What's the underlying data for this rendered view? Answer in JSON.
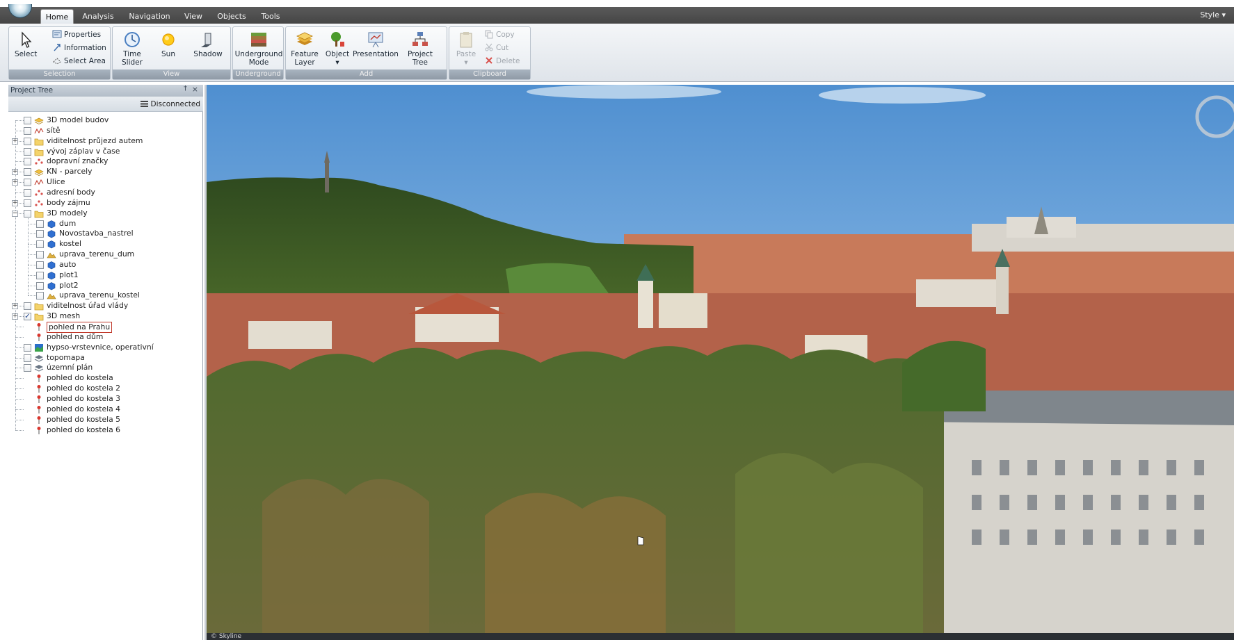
{
  "tabs": [
    "Home",
    "Analysis",
    "Navigation",
    "View",
    "Objects",
    "Tools"
  ],
  "style_menu": "Style",
  "ribbon": {
    "selection": {
      "label": "Selection",
      "select": "Select",
      "properties": "Properties",
      "information": "Information",
      "select_area": "Select Area"
    },
    "view": {
      "label": "View",
      "time_slider_1": "Time",
      "time_slider_2": "Slider",
      "sun": "Sun",
      "shadow": "Shadow"
    },
    "underground": {
      "label": "Underground",
      "mode_1": "Underground",
      "mode_2": "Mode"
    },
    "add": {
      "label": "Add",
      "feature_layer_1": "Feature",
      "feature_layer_2": "Layer",
      "object": "Object",
      "presentation": "Presentation",
      "project_tree_1": "Project",
      "project_tree_2": "Tree"
    },
    "clipboard": {
      "label": "Clipboard",
      "paste": "Paste",
      "copy": "Copy",
      "cut": "Cut",
      "delete": "Delete"
    }
  },
  "panel": {
    "title": "Project Tree",
    "pin": "†",
    "close": "×",
    "connection": "Disconnected"
  },
  "tree": [
    {
      "label": "3D model budov",
      "icon": "layer-icon",
      "expander": "",
      "level": 0,
      "checked": false
    },
    {
      "label": "sítě",
      "icon": "network-icon",
      "expander": "",
      "level": 0,
      "checked": false
    },
    {
      "label": "viditelnost průjezd autem",
      "icon": "folder-icon",
      "expander": "+",
      "level": 0,
      "checked": false
    },
    {
      "label": "vývoj záplav v čase",
      "icon": "folder-icon",
      "expander": "",
      "level": 0,
      "checked": false
    },
    {
      "label": "dopravní značky",
      "icon": "points-icon",
      "expander": "",
      "level": 0,
      "checked": false
    },
    {
      "label": "KN - parcely",
      "icon": "layer-icon",
      "expander": "+",
      "level": 0,
      "checked": false
    },
    {
      "label": "Ulice",
      "icon": "network-icon",
      "expander": "+",
      "level": 0,
      "checked": false
    },
    {
      "label": "adresní body",
      "icon": "points-icon",
      "expander": "",
      "level": 0,
      "checked": false
    },
    {
      "label": "body zájmu",
      "icon": "points-icon",
      "expander": "+",
      "level": 0,
      "checked": false
    },
    {
      "label": "3D modely",
      "icon": "folder-icon",
      "expander": "−",
      "level": 0,
      "checked": false
    },
    {
      "label": "dum",
      "icon": "model-icon",
      "expander": "",
      "level": 1,
      "checked": false
    },
    {
      "label": "Novostavba_nastrel",
      "icon": "model-icon",
      "expander": "",
      "level": 1,
      "checked": false
    },
    {
      "label": "kostel",
      "icon": "model-icon",
      "expander": "",
      "level": 1,
      "checked": false
    },
    {
      "label": "uprava_terenu_dum",
      "icon": "terrain-icon",
      "expander": "",
      "level": 1,
      "checked": false
    },
    {
      "label": "auto",
      "icon": "model-icon",
      "expander": "",
      "level": 1,
      "checked": false
    },
    {
      "label": "plot1",
      "icon": "model-icon",
      "expander": "",
      "level": 1,
      "checked": false
    },
    {
      "label": "plot2",
      "icon": "model-icon",
      "expander": "",
      "level": 1,
      "checked": false
    },
    {
      "label": "uprava_terenu_kostel",
      "icon": "terrain-icon",
      "expander": "",
      "level": 1,
      "checked": false
    },
    {
      "label": "viditelnost úřad vlády",
      "icon": "folder-icon",
      "expander": "+",
      "level": 0,
      "checked": false
    },
    {
      "label": "3D mesh",
      "icon": "folder-icon",
      "expander": "+",
      "level": 0,
      "checked": true
    },
    {
      "label": "pohled na Prahu",
      "icon": "pin-icon",
      "expander": "",
      "level": 0,
      "checked": null,
      "selected": true
    },
    {
      "label": "pohled na dům",
      "icon": "pin-icon",
      "expander": "",
      "level": 0,
      "checked": null
    },
    {
      "label": "hypso-vrstevnice, operativní",
      "icon": "raster-icon",
      "expander": "",
      "level": 0,
      "checked": false
    },
    {
      "label": "topomapa",
      "icon": "stack-icon",
      "expander": "",
      "level": 0,
      "checked": false
    },
    {
      "label": "územní plán",
      "icon": "stack-icon",
      "expander": "",
      "level": 0,
      "checked": false
    },
    {
      "label": "pohled do kostela",
      "icon": "pin-icon",
      "expander": "",
      "level": 0,
      "checked": null
    },
    {
      "label": "pohled do kostela 2",
      "icon": "pin-icon",
      "expander": "",
      "level": 0,
      "checked": null
    },
    {
      "label": "pohled do kostela 3",
      "icon": "pin-icon",
      "expander": "",
      "level": 0,
      "checked": null
    },
    {
      "label": "pohled do kostela 4",
      "icon": "pin-icon",
      "expander": "",
      "level": 0,
      "checked": null
    },
    {
      "label": "pohled do kostela 5",
      "icon": "pin-icon",
      "expander": "",
      "level": 0,
      "checked": null
    },
    {
      "label": "pohled do kostela 6",
      "icon": "pin-icon",
      "expander": "",
      "level": 0,
      "checked": null
    }
  ],
  "status": {
    "text": "© Skyline"
  },
  "colors": {
    "tabbar": "#4d4d4d",
    "ribbon_group_label": "#9aa5b1",
    "sky": "#6fa3d6",
    "roofs": "#b85a3a",
    "foliage": "#4d6b2e"
  }
}
